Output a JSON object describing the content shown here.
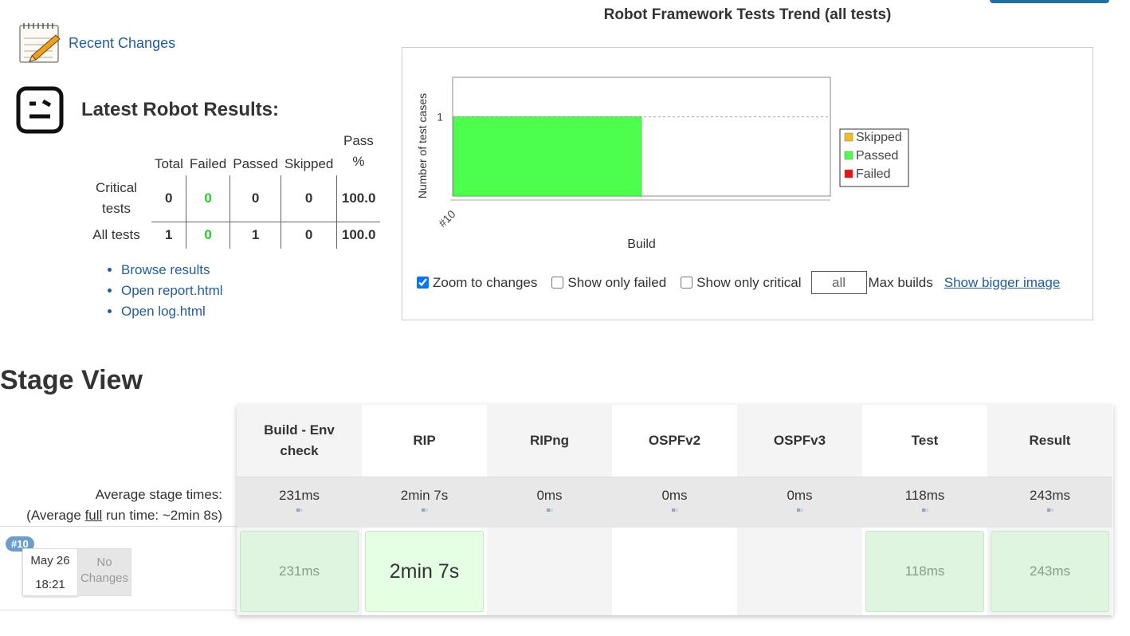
{
  "recent_changes": {
    "label": "Recent Changes"
  },
  "robot": {
    "title": "Latest Robot Results:",
    "columns": [
      "Total",
      "Failed",
      "Passed",
      "Skipped",
      "Pass\n%"
    ],
    "rows": [
      {
        "label": "Critical tests",
        "total": "0",
        "failed": "0",
        "passed": "0",
        "skipped": "0",
        "pass_pct": "100.0"
      },
      {
        "label": "All tests",
        "total": "1",
        "failed": "0",
        "passed": "1",
        "skipped": "0",
        "pass_pct": "100.0"
      }
    ],
    "links": [
      "Browse results",
      "Open report.html",
      "Open log.html"
    ]
  },
  "trend": {
    "title": "Robot Framework Tests Trend (all tests)",
    "controls": {
      "zoom_label": "Zoom to changes",
      "zoom_checked": true,
      "only_failed_label": "Show only failed",
      "only_critical_label": "Show only critical",
      "max_builds_value": "all",
      "max_builds_label": "Max builds",
      "bigger_link": "Show bigger image"
    }
  },
  "chart_data": {
    "type": "area",
    "title": "",
    "xlabel": "Build",
    "ylabel": "Number of test cases",
    "categories": [
      "#10"
    ],
    "ylim": [
      0,
      1.5
    ],
    "yticks": [
      1
    ],
    "series": [
      {
        "name": "Skipped",
        "values": [
          0
        ],
        "color": "#f2c01e"
      },
      {
        "name": "Passed",
        "values": [
          1
        ],
        "color": "#4cff4c"
      },
      {
        "name": "Failed",
        "values": [
          0
        ],
        "color": "#ee1111"
      }
    ],
    "legend": "right"
  },
  "stage_view": {
    "title": "Stage View",
    "avg_label_1": "Average stage times:",
    "avg_label_2_pre": "(Average ",
    "avg_label_2_full": "full",
    "avg_label_2_post": " run time: ~2min 8s)",
    "stages": [
      {
        "name": "Build - Env check",
        "avg": "231ms",
        "run": "231ms",
        "status": "success"
      },
      {
        "name": "RIP",
        "avg": "2min 7s",
        "run": "2min 7s",
        "status": "success"
      },
      {
        "name": "RIPng",
        "avg": "0ms",
        "run": "",
        "status": "none"
      },
      {
        "name": "OSPFv2",
        "avg": "0ms",
        "run": "",
        "status": "none"
      },
      {
        "name": "OSPFv3",
        "avg": "0ms",
        "run": "",
        "status": "none"
      },
      {
        "name": "Test",
        "avg": "118ms",
        "run": "118ms",
        "status": "success"
      },
      {
        "name": "Result",
        "avg": "243ms",
        "run": "243ms",
        "status": "success"
      }
    ],
    "run": {
      "badge": "#10",
      "date": "May 26",
      "time": "18:21",
      "changes": "No Changes"
    }
  }
}
